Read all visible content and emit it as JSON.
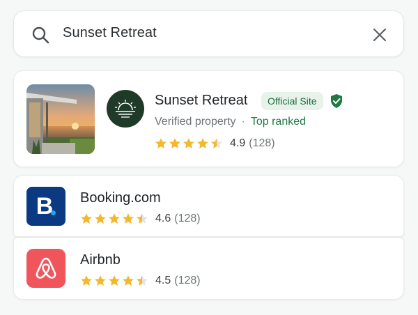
{
  "search": {
    "query": "Sunset Retreat"
  },
  "main_result": {
    "title": "Sunset Retreat",
    "badge": "Official Site",
    "subtitle": "Verified property",
    "separator": "·",
    "rank_label": "Top ranked",
    "rating": "4.9",
    "rating_count": "(128)",
    "stars": 4.5,
    "icons": [
      "sunset-logo-icon",
      "verified-shield-icon"
    ]
  },
  "results": [
    {
      "title": "Booking.com",
      "logo_letter": "B",
      "rating": "4.6",
      "rating_count": "(128)",
      "stars": 4.5
    },
    {
      "title": "Airbnb",
      "rating": "4.5",
      "rating_count": "(128)",
      "stars": 4.5
    }
  ],
  "colors": {
    "accent_green": "#1f7a45",
    "badge_bg": "#e6f2ea",
    "star": "#f4b82c",
    "booking_blue": "#0b3a82",
    "airbnb_red": "#f0555c"
  }
}
